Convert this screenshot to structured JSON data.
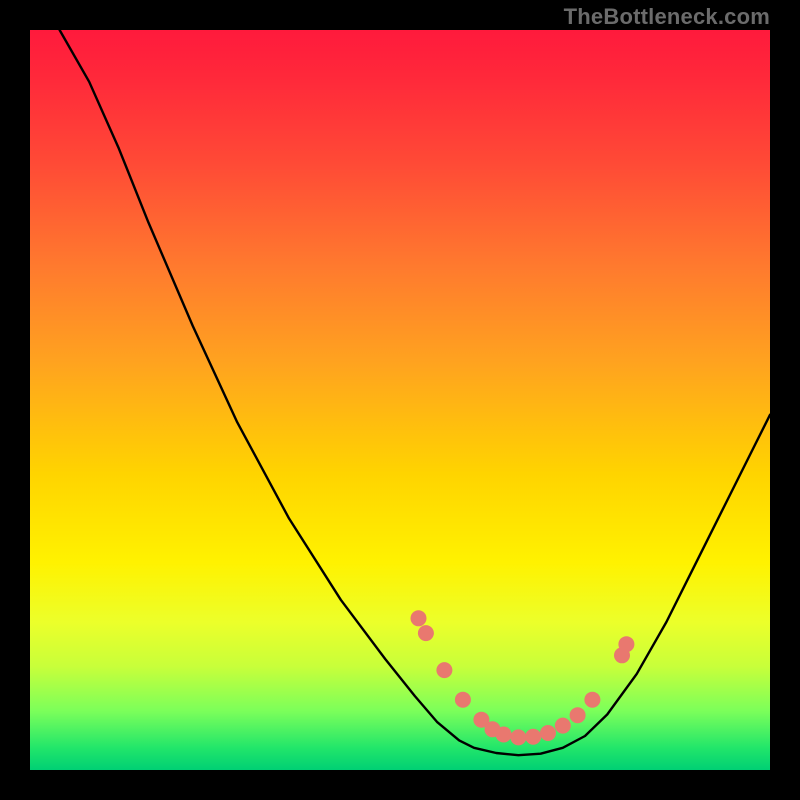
{
  "watermark": "TheBottleneck.com",
  "chart_data": {
    "type": "line",
    "title": "",
    "xlabel": "",
    "ylabel": "",
    "xlim": [
      0,
      100
    ],
    "ylim": [
      0,
      100
    ],
    "curve": [
      {
        "x": 4,
        "y": 100
      },
      {
        "x": 8,
        "y": 93
      },
      {
        "x": 12,
        "y": 84
      },
      {
        "x": 16,
        "y": 74
      },
      {
        "x": 22,
        "y": 60
      },
      {
        "x": 28,
        "y": 47
      },
      {
        "x": 35,
        "y": 34
      },
      {
        "x": 42,
        "y": 23
      },
      {
        "x": 48,
        "y": 15
      },
      {
        "x": 52,
        "y": 10
      },
      {
        "x": 55,
        "y": 6.5
      },
      {
        "x": 58,
        "y": 4.0
      },
      {
        "x": 60,
        "y": 3.0
      },
      {
        "x": 63,
        "y": 2.3
      },
      {
        "x": 66,
        "y": 2.0
      },
      {
        "x": 69,
        "y": 2.2
      },
      {
        "x": 72,
        "y": 3.0
      },
      {
        "x": 75,
        "y": 4.6
      },
      {
        "x": 78,
        "y": 7.5
      },
      {
        "x": 82,
        "y": 13
      },
      {
        "x": 86,
        "y": 20
      },
      {
        "x": 90,
        "y": 28
      },
      {
        "x": 94,
        "y": 36
      },
      {
        "x": 98,
        "y": 44
      },
      {
        "x": 100,
        "y": 48
      }
    ],
    "markers": [
      {
        "x": 52.5,
        "y": 20.5
      },
      {
        "x": 53.5,
        "y": 18.5
      },
      {
        "x": 56,
        "y": 13.5
      },
      {
        "x": 58.5,
        "y": 9.5
      },
      {
        "x": 61,
        "y": 6.8
      },
      {
        "x": 62.5,
        "y": 5.5
      },
      {
        "x": 64,
        "y": 4.8
      },
      {
        "x": 66,
        "y": 4.4
      },
      {
        "x": 68,
        "y": 4.5
      },
      {
        "x": 70,
        "y": 5.0
      },
      {
        "x": 72,
        "y": 6.0
      },
      {
        "x": 74,
        "y": 7.4
      },
      {
        "x": 76,
        "y": 9.5
      },
      {
        "x": 80,
        "y": 15.5
      },
      {
        "x": 80.6,
        "y": 17.0
      }
    ],
    "colors": {
      "curve": "#000000",
      "marker": "#e9786f"
    }
  }
}
